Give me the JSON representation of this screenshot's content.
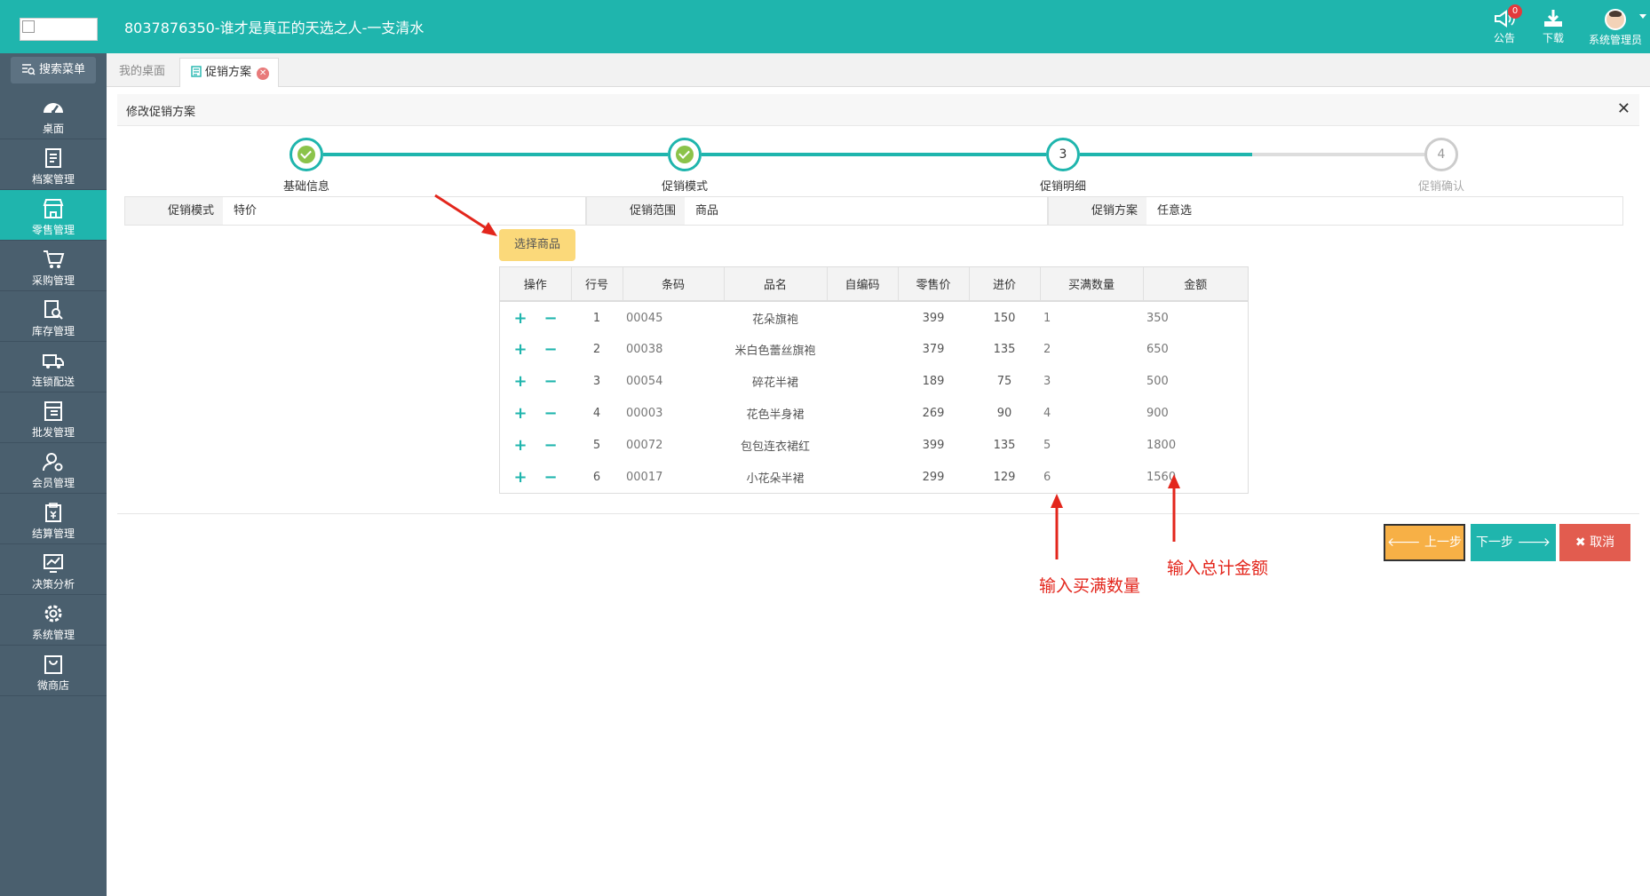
{
  "header": {
    "title": "8037876350-谁才是真正的天选之人-一支清水",
    "notice_label": "公告",
    "notice_count": "0",
    "download_label": "下载",
    "user_label": "系统管理员"
  },
  "sidebar": {
    "search_label": "搜索菜单",
    "items": [
      {
        "label": "桌面",
        "icon": "dashboard-icon"
      },
      {
        "label": "档案管理",
        "icon": "archive-icon"
      },
      {
        "label": "零售管理",
        "icon": "store-icon",
        "active": true
      },
      {
        "label": "采购管理",
        "icon": "cart-icon"
      },
      {
        "label": "库存管理",
        "icon": "inventory-search-icon"
      },
      {
        "label": "连锁配送",
        "icon": "truck-icon"
      },
      {
        "label": "批发管理",
        "icon": "wholesale-icon"
      },
      {
        "label": "会员管理",
        "icon": "member-icon"
      },
      {
        "label": "结算管理",
        "icon": "settlement-icon"
      },
      {
        "label": "决策分析",
        "icon": "chart-icon"
      },
      {
        "label": "系统管理",
        "icon": "gear-icon"
      },
      {
        "label": "微商店",
        "icon": "shop-bag-icon"
      }
    ]
  },
  "tabs": {
    "home": "我的桌面",
    "promo": "促销方案"
  },
  "panel": {
    "title": "修改促销方案"
  },
  "steps": [
    {
      "label": "基础信息",
      "state": "done"
    },
    {
      "label": "促销模式",
      "state": "done"
    },
    {
      "label": "促销明细",
      "state": "current",
      "number": "3"
    },
    {
      "label": "促销确认",
      "state": "todo",
      "number": "4"
    }
  ],
  "info": {
    "mode_label": "促销模式",
    "mode_value": "特价",
    "scope_label": "促销范围",
    "scope_value": "商品",
    "plan_label": "促销方案",
    "plan_value": "任意选"
  },
  "select_button": "选择商品",
  "table": {
    "headers": [
      "操作",
      "行号",
      "条码",
      "品名",
      "自编码",
      "零售价",
      "进价",
      "买满数量",
      "金额"
    ],
    "rows": [
      {
        "no": "1",
        "barcode": "00045",
        "name": "花朵旗袍",
        "code": "",
        "retail": "399",
        "cost": "150",
        "qty": "1",
        "amount": "350"
      },
      {
        "no": "2",
        "barcode": "00038",
        "name": "米白色蕾丝旗袍",
        "code": "",
        "retail": "379",
        "cost": "135",
        "qty": "2",
        "amount": "650"
      },
      {
        "no": "3",
        "barcode": "00054",
        "name": "碎花半裙",
        "code": "",
        "retail": "189",
        "cost": "75",
        "qty": "3",
        "amount": "500"
      },
      {
        "no": "4",
        "barcode": "00003",
        "name": "花色半身裙",
        "code": "",
        "retail": "269",
        "cost": "90",
        "qty": "4",
        "amount": "900"
      },
      {
        "no": "5",
        "barcode": "00072",
        "name": "包包连衣裙红",
        "code": "",
        "retail": "399",
        "cost": "135",
        "qty": "5",
        "amount": "1800"
      },
      {
        "no": "6",
        "barcode": "00017",
        "name": "小花朵半裙",
        "code": "",
        "retail": "299",
        "cost": "129",
        "qty": "6",
        "amount": "1560"
      }
    ],
    "add_symbol": "+",
    "del_symbol": "−"
  },
  "buttons": {
    "prev": "上一步",
    "next": "下一步",
    "cancel": "取消"
  },
  "annotations": {
    "qty_note": "输入买满数量",
    "amount_note": "输入总计金额"
  },
  "colors": {
    "primary": "#1fb5ad",
    "sidebar": "#4a5f6e",
    "prev_button": "#f7b046",
    "cancel_button": "#e25c4f",
    "select_button": "#fbd97a",
    "annotation": "#e3261c"
  }
}
